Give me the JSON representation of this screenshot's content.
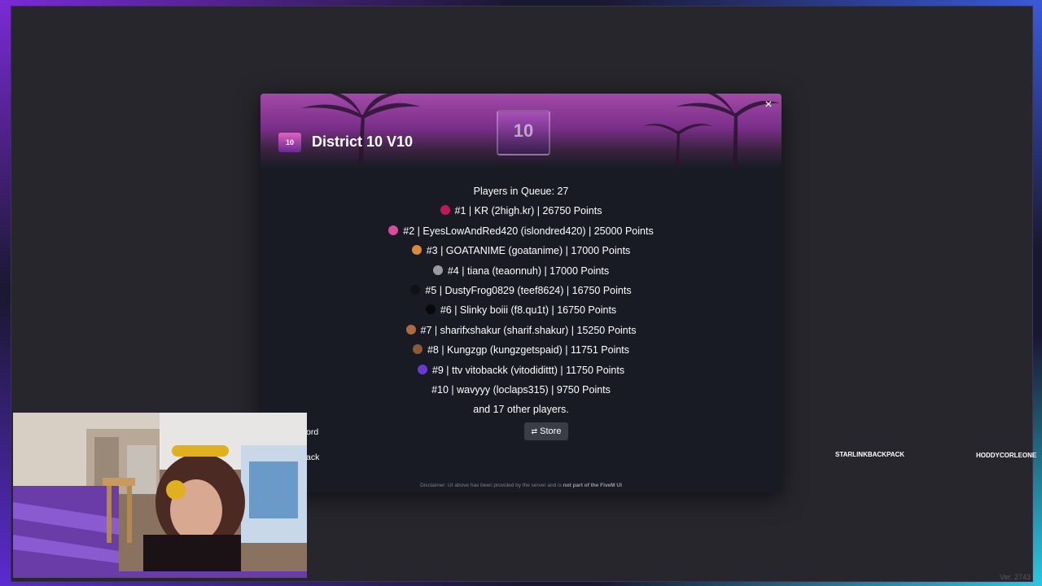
{
  "server": {
    "title": "District 10 V10",
    "logo_text": "10",
    "close_label": "×"
  },
  "queue": {
    "header": "Players in Queue: 27",
    "players": [
      {
        "text": "#1 | KR (2high.kr) | 26750 Points",
        "avatar_color": "#c2185b"
      },
      {
        "text": "#2 | EyesLowAndRed420 (islondred420) | 25000 Points",
        "avatar_color": "#d84d9b"
      },
      {
        "text": "#3 | GOATANIME (goatanime) | 17000 Points",
        "avatar_color": "#d98a3a"
      },
      {
        "text": "#4 | tiana (teaonnuh) | 17000 Points",
        "avatar_color": "#9a9aa0"
      },
      {
        "text": "#5 | DustyFrog0829 (teef8624) | 16750 Points",
        "avatar_color": "#111115"
      },
      {
        "text": "#6 | Slinky boiii (f8.qu1t) | 16750 Points",
        "avatar_color": "#08080a"
      },
      {
        "text": "#7 | sharifxshakur (sharif.shakur) | 15250 Points",
        "avatar_color": "#b06a40"
      },
      {
        "text": "#8 | Kungzgp (kungzgetspaid) | 11751 Points",
        "avatar_color": "#8a5a3a"
      },
      {
        "text": "#9 | ttv vitobackk (vitodidittt) | 11750 Points",
        "avatar_color": "#6a3ad0"
      },
      {
        "text": "#10 | wavyyy (loclaps315) | 9750 Points",
        "avatar_color": ""
      }
    ],
    "others": "and 17 other players."
  },
  "buttons": {
    "store": "Store",
    "store_icon": "⇄",
    "discord_partial": "ord",
    "back_partial": "ack"
  },
  "disclaimer": {
    "text": "Disclaimer: UI above has been provided by the server and is ",
    "bold": "not part of the FiveM UI"
  },
  "name_tags": [
    "STARLINKBACKPACK",
    "HODDYCORLEONE"
  ],
  "version": "Ver. 2743",
  "colors": {
    "banner": "#a24aa8",
    "modal_bg": "#181b24",
    "frame_glow": "#7a2bd6"
  }
}
